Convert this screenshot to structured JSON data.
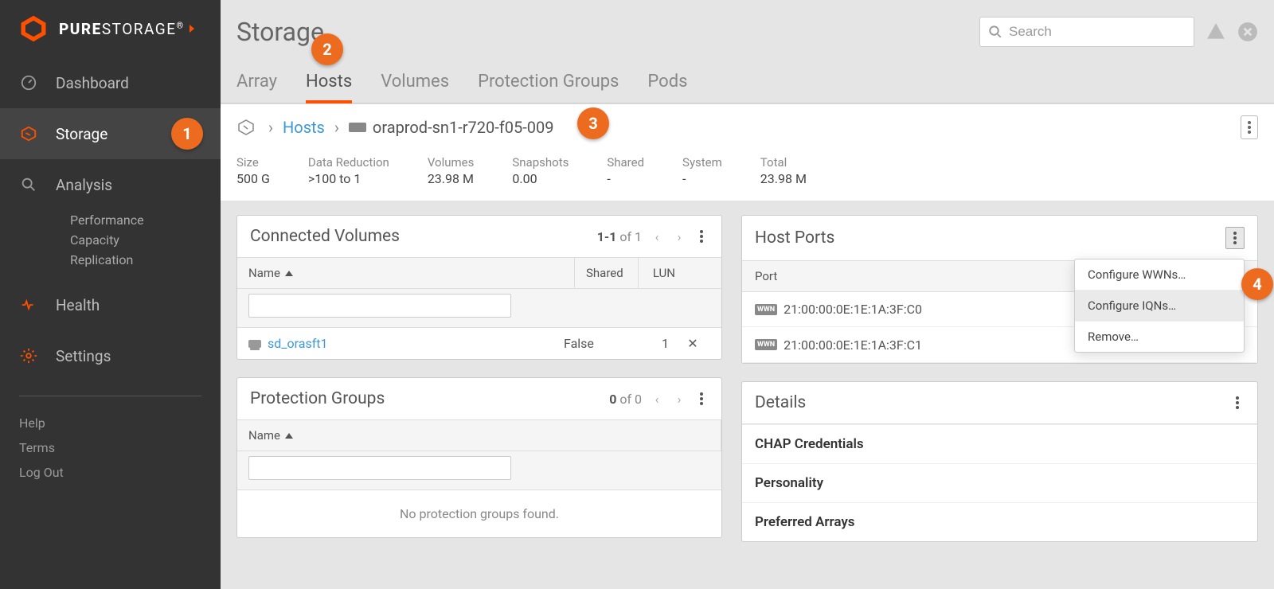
{
  "brand": {
    "bold": "PURE",
    "rest": "STORAGE",
    "suffix": "®"
  },
  "sidebar": {
    "items": [
      {
        "label": "Dashboard"
      },
      {
        "label": "Storage"
      },
      {
        "label": "Analysis"
      },
      {
        "label": "Health"
      },
      {
        "label": "Settings"
      }
    ],
    "analysis_sub": [
      "Performance",
      "Capacity",
      "Replication"
    ],
    "footer": [
      "Help",
      "Terms",
      "Log Out"
    ]
  },
  "page": {
    "title": "Storage"
  },
  "search": {
    "placeholder": "Search"
  },
  "tabs": [
    "Array",
    "Hosts",
    "Volumes",
    "Protection Groups",
    "Pods"
  ],
  "breadcrumb": {
    "link": "Hosts",
    "current": "oraprod-sn1-r720-f05-009"
  },
  "stats": [
    {
      "label": "Size",
      "value": "500 G"
    },
    {
      "label": "Data Reduction",
      "value": ">100 to 1"
    },
    {
      "label": "Volumes",
      "value": "23.98 M"
    },
    {
      "label": "Snapshots",
      "value": "0.00"
    },
    {
      "label": "Shared",
      "value": "-"
    },
    {
      "label": "System",
      "value": "-"
    },
    {
      "label": "Total",
      "value": "23.98 M"
    }
  ],
  "connected_volumes": {
    "title": "Connected Volumes",
    "page": {
      "range": "1-1",
      "of_word": " of ",
      "total": "1"
    },
    "cols": {
      "name": "Name",
      "shared": "Shared",
      "lun": "LUN"
    },
    "rows": [
      {
        "name": "sd_orasft1",
        "shared": "False",
        "lun": "1"
      }
    ]
  },
  "protection_groups": {
    "title": "Protection Groups",
    "page": {
      "range": "0",
      "of_word": " of ",
      "total": "0"
    },
    "cols": {
      "name": "Name"
    },
    "empty": "No protection groups found."
  },
  "host_ports": {
    "title": "Host Ports",
    "col": "Port",
    "rows": [
      {
        "badge": "WWN",
        "value": "21:00:00:0E:1E:1A:3F:C0"
      },
      {
        "badge": "WWN",
        "value": "21:00:00:0E:1E:1A:3F:C1"
      }
    ],
    "menu": [
      "Configure WWNs…",
      "Configure IQNs…",
      "Remove…"
    ]
  },
  "details": {
    "title": "Details",
    "rows": [
      "CHAP Credentials",
      "Personality",
      "Preferred Arrays"
    ]
  },
  "badges": [
    "1",
    "2",
    "3",
    "4"
  ]
}
